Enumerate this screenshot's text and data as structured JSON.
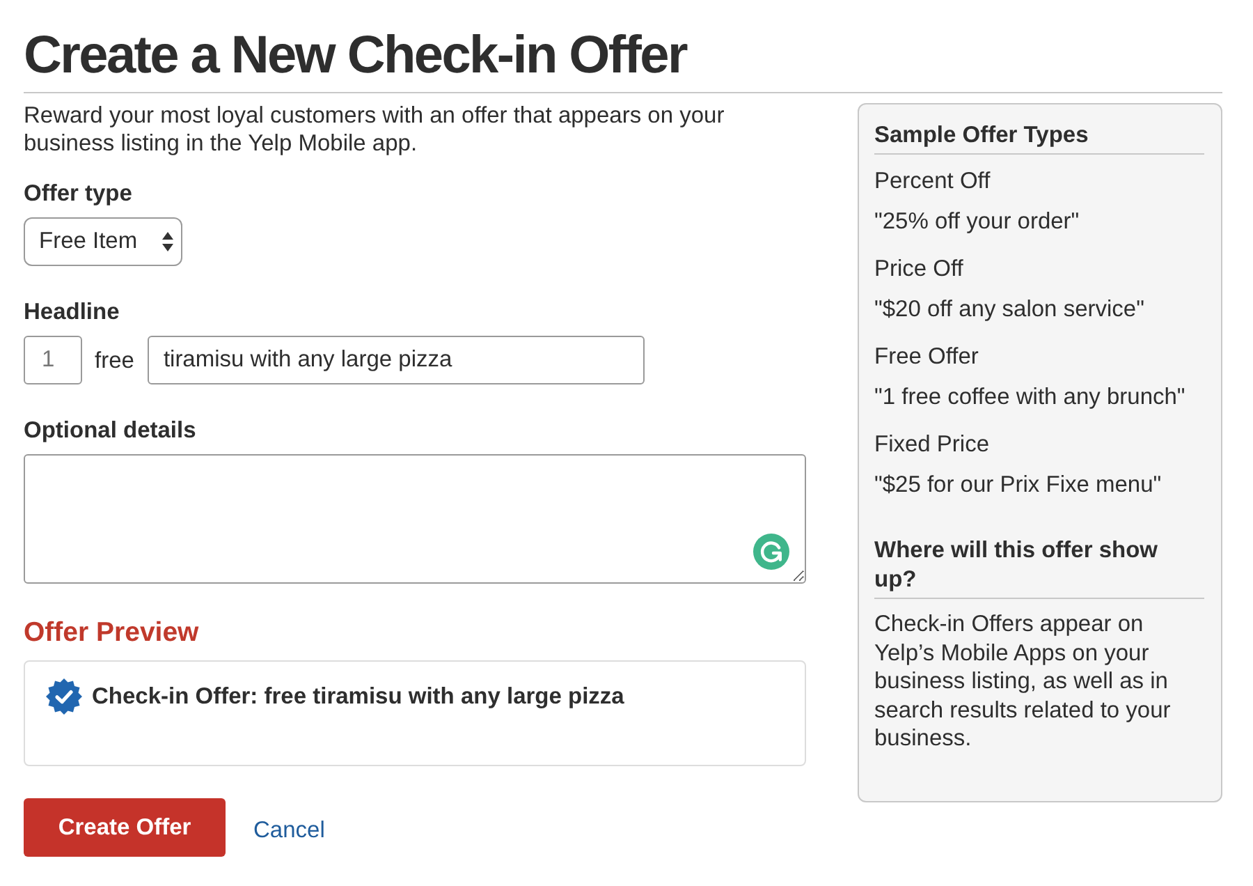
{
  "page": {
    "title": "Create a New Check-in Offer",
    "intro": "Reward your most loyal customers with an offer that appears on your business listing in the Yelp Mobile app."
  },
  "form": {
    "offer_type": {
      "label": "Offer type",
      "value": "Free Item"
    },
    "headline": {
      "label": "Headline",
      "quantity_placeholder": "1",
      "connector": "free",
      "item": "tiramisu with any large pizza"
    },
    "details": {
      "label": "Optional details"
    },
    "preview": {
      "heading": "Offer Preview",
      "text": "Check-in Offer: free tiramisu with any large pizza"
    },
    "actions": {
      "submit": "Create Offer",
      "cancel": "Cancel"
    }
  },
  "sidebar": {
    "sections": [
      {
        "kind": "examples",
        "title": "Sample Offer Types",
        "items": [
          {
            "name": "Percent Off",
            "example": "\"25% off your order\""
          },
          {
            "name": "Price Off",
            "example": "\"$20 off any salon service\""
          },
          {
            "name": "Free Offer",
            "example": "\"1 free coffee with any brunch\""
          },
          {
            "name": "Fixed Price",
            "example": "\"$25 for our Prix Fixe menu\""
          }
        ]
      },
      {
        "kind": "text",
        "title": "Where will this offer show up?",
        "body": "Check-in Offers appear on Yelp’s Mobile Apps on your business listing, as well as in search results related to your business."
      }
    ]
  }
}
